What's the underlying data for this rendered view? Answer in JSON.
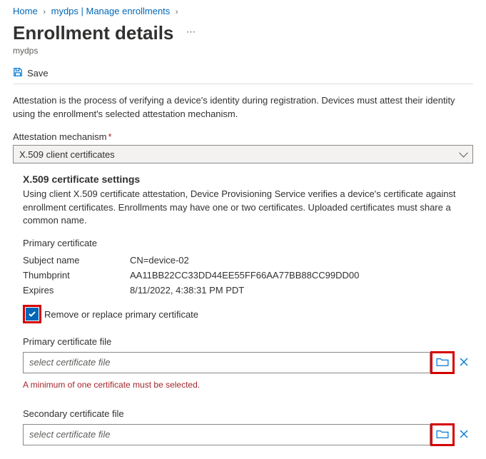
{
  "breadcrumb": {
    "home": "Home",
    "path": "mydps | Manage enrollments"
  },
  "page": {
    "title": "Enrollment details",
    "subtitle": "mydps"
  },
  "toolbar": {
    "save_label": "Save"
  },
  "intro": "Attestation is the process of verifying a device's identity during registration. Devices must attest their identity using the enrollment's selected attestation mechanism.",
  "attestation": {
    "label": "Attestation mechanism",
    "value": "X.509 client certificates"
  },
  "x509": {
    "heading": "X.509 certificate settings",
    "desc": "Using client X.509 certificate attestation, Device Provisioning Service verifies a device's certificate against enrollment certificates. Enrollments may have one or two certificates. Uploaded certificates must share a common name.",
    "primary_label": "Primary certificate",
    "rows": {
      "subject_key": "Subject name",
      "subject_val": "CN=device-02",
      "thumb_key": "Thumbprint",
      "thumb_val": "AA11BB22CC33DD44EE55FF66AA77BB88CC99DD00",
      "expires_key": "Expires",
      "expires_val": "8/11/2022, 4:38:31 PM PDT"
    },
    "remove_label": "Remove or replace primary certificate",
    "primary_file_label": "Primary certificate file",
    "file_placeholder": "select certificate file",
    "error": "A minimum of one certificate must be selected.",
    "secondary_file_label": "Secondary certificate file"
  }
}
